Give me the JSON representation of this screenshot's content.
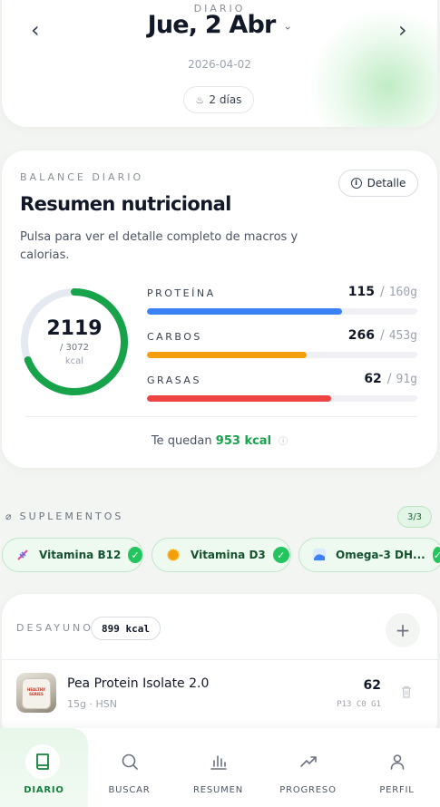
{
  "header": {
    "kicker": "DIARIO",
    "date": "Jue, 2 Abr",
    "iso_date": "2026-04-02",
    "streak_label": "2 días",
    "prev_icon": "chevron-left-icon",
    "next_icon": "chevron-right-icon"
  },
  "balance": {
    "kicker": "BALANCE DIARIO",
    "title": "Resumen nutricional",
    "subtitle": "Pulsa para ver el detalle completo de macros y calorias.",
    "detail_label": "Detalle",
    "calories": {
      "consumed": "2119",
      "goal_text": "/ 3072",
      "unit": "kcal",
      "progress": 0.69
    },
    "macros": [
      {
        "label": "PROTEÍNA",
        "current": "115",
        "goal": "160g",
        "progress": 0.72,
        "color": "#3b82f6"
      },
      {
        "label": "CARBOS",
        "current": "266",
        "goal": "453g",
        "progress": 0.59,
        "color": "#f59e0b"
      },
      {
        "label": "GRASAS",
        "current": "62",
        "goal": "91g",
        "progress": 0.68,
        "color": "#ef4444"
      }
    ],
    "remaining_prefix": "Te quedan",
    "remaining_kcal": "953 kcal",
    "accent_color": "#16a34a"
  },
  "supplements": {
    "kicker": "SUPLEMENTOS",
    "count": "3/3",
    "items": [
      {
        "name": "Vitamina B12",
        "icon": "dna-icon"
      },
      {
        "name": "Vitamina D3",
        "icon": "sun-icon"
      },
      {
        "name": "Omega-3 DH...",
        "icon": "wave-icon"
      }
    ]
  },
  "meal": {
    "kicker": "DESAYUNO",
    "kcal": "899 kcal",
    "items": [
      {
        "name": "Pea Protein Isolate 2.0",
        "meta": "15g · HSN",
        "kcal": "62",
        "macros": "P13 C0 G1",
        "image_text": "HEALTHY SERIES"
      }
    ]
  },
  "nav": [
    {
      "label": "DIARIO",
      "icon": "book-icon",
      "active": true
    },
    {
      "label": "BUSCAR",
      "icon": "search-icon",
      "active": false
    },
    {
      "label": "RESUMEN",
      "icon": "bar-chart-icon",
      "active": false
    },
    {
      "label": "PROGRESO",
      "icon": "trending-up-icon",
      "active": false
    },
    {
      "label": "PERFIL",
      "icon": "user-icon",
      "active": false
    }
  ]
}
